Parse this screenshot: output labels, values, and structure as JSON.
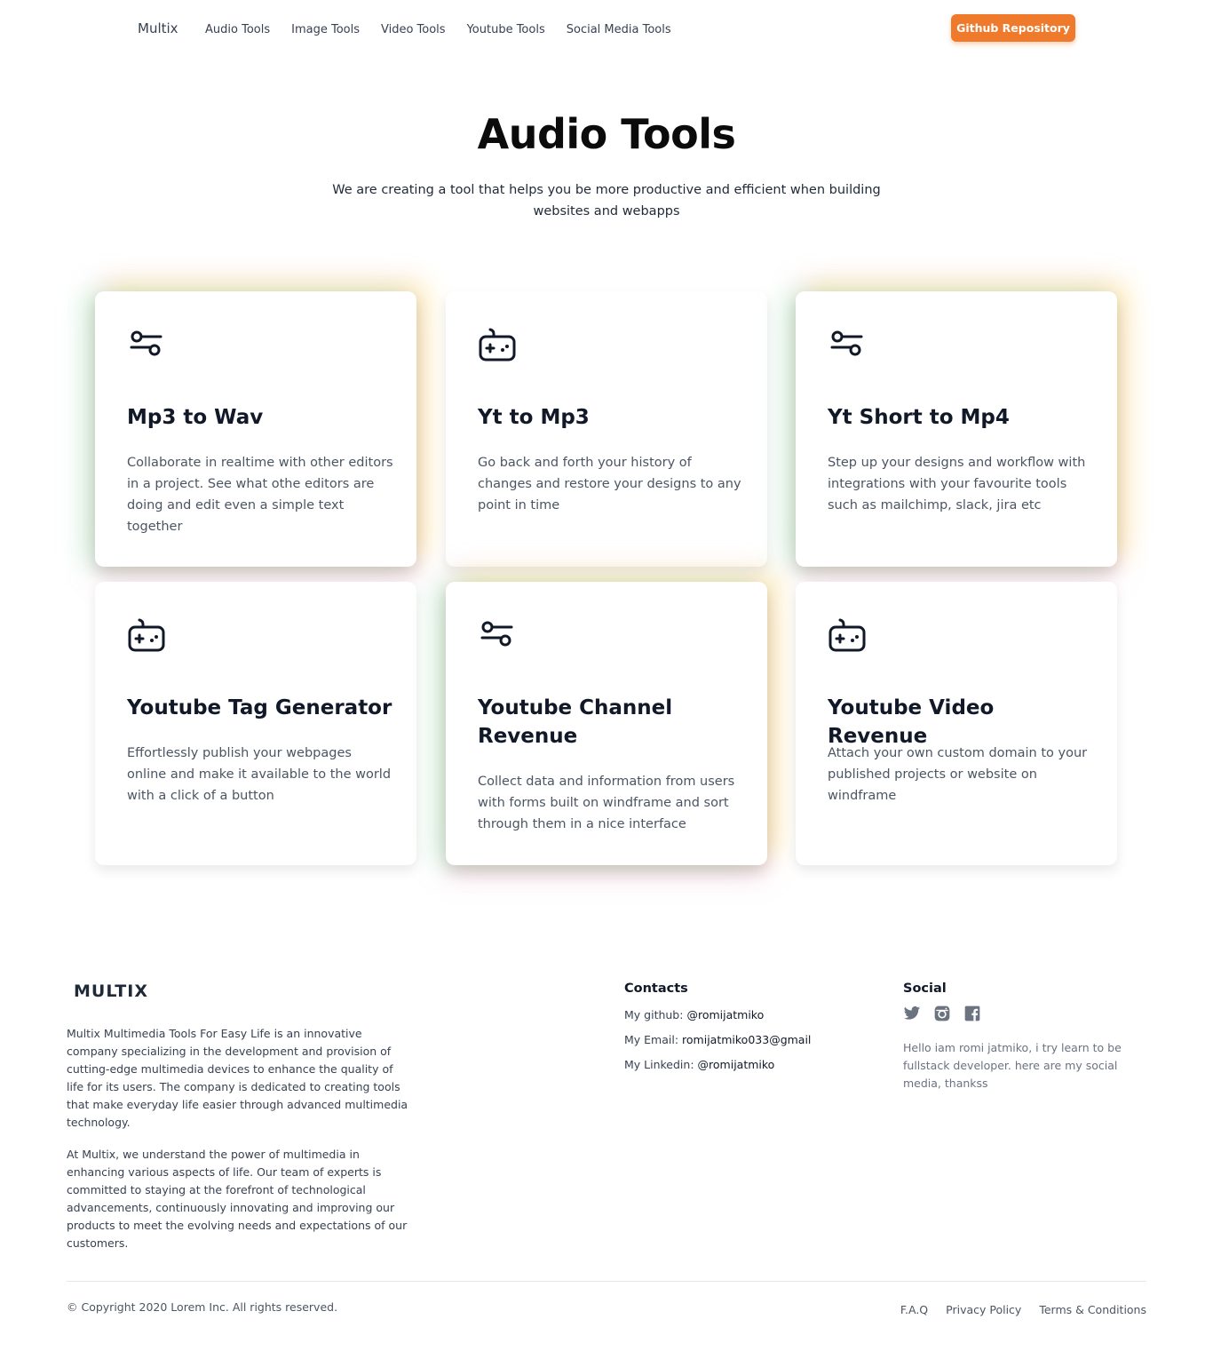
{
  "nav": {
    "brand": "Multix",
    "links": [
      "Audio Tools",
      "Image Tools",
      "Video Tools",
      "Youtube Tools",
      "Social Media Tools"
    ],
    "cta": "Github Repository",
    "cta_color": "#f07a2b"
  },
  "hero": {
    "title": "Audio Tools",
    "subtitle": "We are creating a tool that helps you be more productive and efficient when building websites and webapps"
  },
  "cards": [
    {
      "icon": "sliders-icon",
      "title": "Mp3 to Wav",
      "desc": "Collaborate in realtime with other editors in a project. See what othe editors are doing and edit even a simple text together"
    },
    {
      "icon": "gamepad-icon",
      "title": "Yt to Mp3",
      "desc": "Go back and forth your history of changes and restore your designs to any point in time"
    },
    {
      "icon": "sliders-icon",
      "title": "Yt Short to Mp4",
      "desc": "Step up your designs and workflow with integrations with your favourite tools such as mailchimp, slack, jira etc"
    },
    {
      "icon": "gamepad-icon",
      "title": "Youtube Tag Generator",
      "desc": "Effortlessly publish your webpages online and make it available to the world with a click of a button"
    },
    {
      "icon": "sliders-icon",
      "title": "Youtube Channel Revenue",
      "desc": "Collect data and information from users with forms built on windframe and sort through them in a nice interface"
    },
    {
      "icon": "gamepad-icon",
      "title": "Youtube Video Revenue",
      "desc": "Attach your own custom domain to your published projects or website on windframe"
    }
  ],
  "footer": {
    "brand": "MULTIX",
    "para1": "Multix Multimedia Tools For Easy Life is an innovative company specializing in the development and provision of cutting-edge multimedia devices to enhance the quality of life for its users. The company is dedicated to creating tools that make everyday life easier through advanced multimedia technology.",
    "para2": "At Multix, we understand the power of multimedia in enhancing various aspects of life. Our team of experts is committed to staying at the forefront of technological advancements, continuously innovating and improving our products to meet the evolving needs and expectations of our customers.",
    "contacts_heading": "Contacts",
    "contacts": [
      {
        "label": "My github:",
        "value": "@romijatmiko"
      },
      {
        "label": "My Email:",
        "value": "romijatmiko033@gmail"
      },
      {
        "label": "My Linkedin:",
        "value": "@romijatmiko"
      }
    ],
    "social_heading": "Social",
    "social_icons": [
      "twitter-icon",
      "instagram-icon",
      "facebook-icon"
    ],
    "social_text": "Hello iam romi jatmiko, i try learn to be fullstack developer. here are my social media, thankss",
    "copyright": "© Copyright 2020 Lorem Inc. All rights reserved.",
    "links": [
      "F.A.Q",
      "Privacy Policy",
      "Terms & Conditions"
    ]
  }
}
